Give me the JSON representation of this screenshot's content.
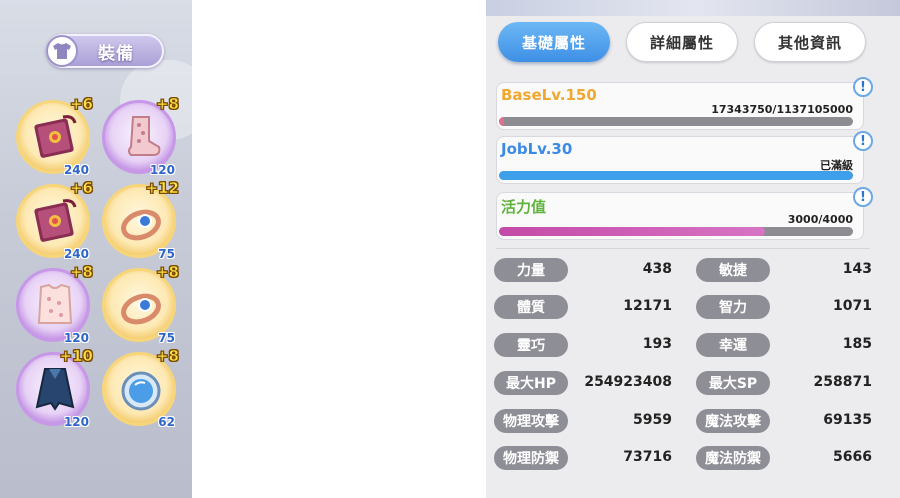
{
  "equipment": {
    "button_label": "裝備",
    "slots": [
      {
        "plus": "+6",
        "level": "240",
        "icon": "book-icon",
        "frame": "gold"
      },
      {
        "plus": "+8",
        "level": "120",
        "icon": "boot-icon",
        "frame": "purple"
      },
      {
        "plus": "+6",
        "level": "240",
        "icon": "book-icon",
        "frame": "gold"
      },
      {
        "plus": "+12",
        "level": "75",
        "icon": "ring-icon",
        "frame": "gold"
      },
      {
        "plus": "+8",
        "level": "120",
        "icon": "armor-icon",
        "frame": "purple"
      },
      {
        "plus": "+8",
        "level": "75",
        "icon": "ring-icon",
        "frame": "gold"
      },
      {
        "plus": "+10",
        "level": "120",
        "icon": "cloak-icon",
        "frame": "purple"
      },
      {
        "plus": "+8",
        "level": "62",
        "icon": "mirror-icon",
        "frame": "gold"
      }
    ]
  },
  "tabs": [
    {
      "label": "基礎屬性",
      "active": true
    },
    {
      "label": "詳細屬性",
      "active": false
    },
    {
      "label": "其他資訊",
      "active": false
    }
  ],
  "bars": {
    "base": {
      "title": "BaseLv.150",
      "value": "17343750/1137105000",
      "progress": 0.015,
      "color": "#f0a830",
      "fill": "#e07090"
    },
    "job": {
      "title": "JobLv.30",
      "value": "已滿級",
      "progress": 1.0,
      "color": "#3a8ae6",
      "fill": "#3ea0ea"
    },
    "vitality": {
      "title": "活力值",
      "value": "3000/4000",
      "progress": 0.75,
      "color": "#5fb33a",
      "fill": "#c44aa8"
    }
  },
  "stats": [
    {
      "left_label": "力量",
      "left_value": "438",
      "right_label": "敏捷",
      "right_value": "143"
    },
    {
      "left_label": "體質",
      "left_value": "12171",
      "right_label": "智力",
      "right_value": "1071"
    },
    {
      "left_label": "靈巧",
      "left_value": "193",
      "right_label": "幸運",
      "right_value": "185"
    },
    {
      "left_label": "最大HP",
      "left_value": "254923408",
      "right_label": "最大SP",
      "right_value": "258871"
    },
    {
      "left_label": "物理攻擊",
      "left_value": "5959",
      "right_label": "魔法攻擊",
      "right_value": "69135"
    },
    {
      "left_label": "物理防禦",
      "left_value": "73716",
      "right_label": "魔法防禦",
      "right_value": "5666"
    }
  ],
  "info_glyph": "!"
}
